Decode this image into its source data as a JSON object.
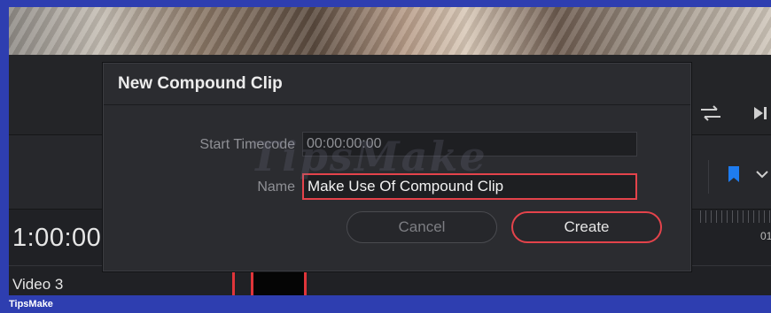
{
  "dialog": {
    "title": "New Compound Clip",
    "start_timecode_label": "Start Timecode",
    "start_timecode_value": "00:00:00:00",
    "name_label": "Name",
    "name_value": "Make Use Of Compound Clip",
    "cancel_label": "Cancel",
    "create_label": "Create"
  },
  "timeline": {
    "timecode": "1:00:00",
    "track_label": "Video 3",
    "ruler_label": "01"
  },
  "watermark": {
    "text": "TipsMake"
  },
  "footer": {
    "brand": "TipsMake"
  },
  "icons": {
    "loop": "loop-icon",
    "skip_end": "skip-to-end-icon",
    "flag": "flag-icon",
    "chevron": "chevron-down-icon"
  },
  "colors": {
    "accent_red": "#e4434b",
    "flag_blue": "#1e7cf0",
    "frame_bg": "#1d1e22"
  }
}
